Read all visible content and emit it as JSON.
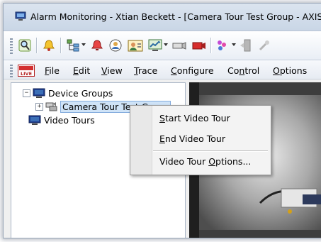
{
  "window": {
    "title": "Alarm Monitoring - Xtian Beckett - [Camera Tour Test Group - AXIS"
  },
  "toolbar": {
    "buttons": [
      {
        "icon": "magnifier-icon"
      },
      {
        "icon": "alarm-bell-icon"
      },
      {
        "icon": "hierarchy-icon"
      },
      {
        "icon": "red-alert-icon"
      },
      {
        "icon": "badge-icon"
      },
      {
        "icon": "cardholder-icon"
      },
      {
        "icon": "monitor-chart-icon"
      },
      {
        "icon": "camera-icon"
      },
      {
        "icon": "video-recorder-icon"
      },
      {
        "icon": "paint-icon"
      },
      {
        "icon": "door-icon"
      }
    ]
  },
  "menubar": {
    "items": [
      {
        "pre": "",
        "key": "F",
        "post": "ile"
      },
      {
        "pre": "",
        "key": "E",
        "post": "dit"
      },
      {
        "pre": "",
        "key": "V",
        "post": "iew"
      },
      {
        "pre": "",
        "key": "T",
        "post": "race"
      },
      {
        "pre": "",
        "key": "C",
        "post": "onfigure"
      },
      {
        "pre": "Co",
        "key": "n",
        "post": "trol"
      },
      {
        "pre": "",
        "key": "O",
        "post": "ptions"
      }
    ]
  },
  "tree": {
    "root": {
      "label": "Device Groups",
      "expander": "−"
    },
    "child": {
      "label": "Camera Tour Test Group",
      "expander": "+"
    },
    "second_root": {
      "label": "Video Tours"
    }
  },
  "context_menu": {
    "items": [
      {
        "pre": "",
        "key": "S",
        "post": "tart Video Tour"
      },
      {
        "pre": "",
        "key": "E",
        "post": "nd Video Tour"
      },
      {
        "pre": "Video Tour ",
        "key": "O",
        "post": "ptions..."
      }
    ]
  },
  "colors": {
    "accent": "#3b6fb6",
    "selection": "#cfe3f7"
  }
}
